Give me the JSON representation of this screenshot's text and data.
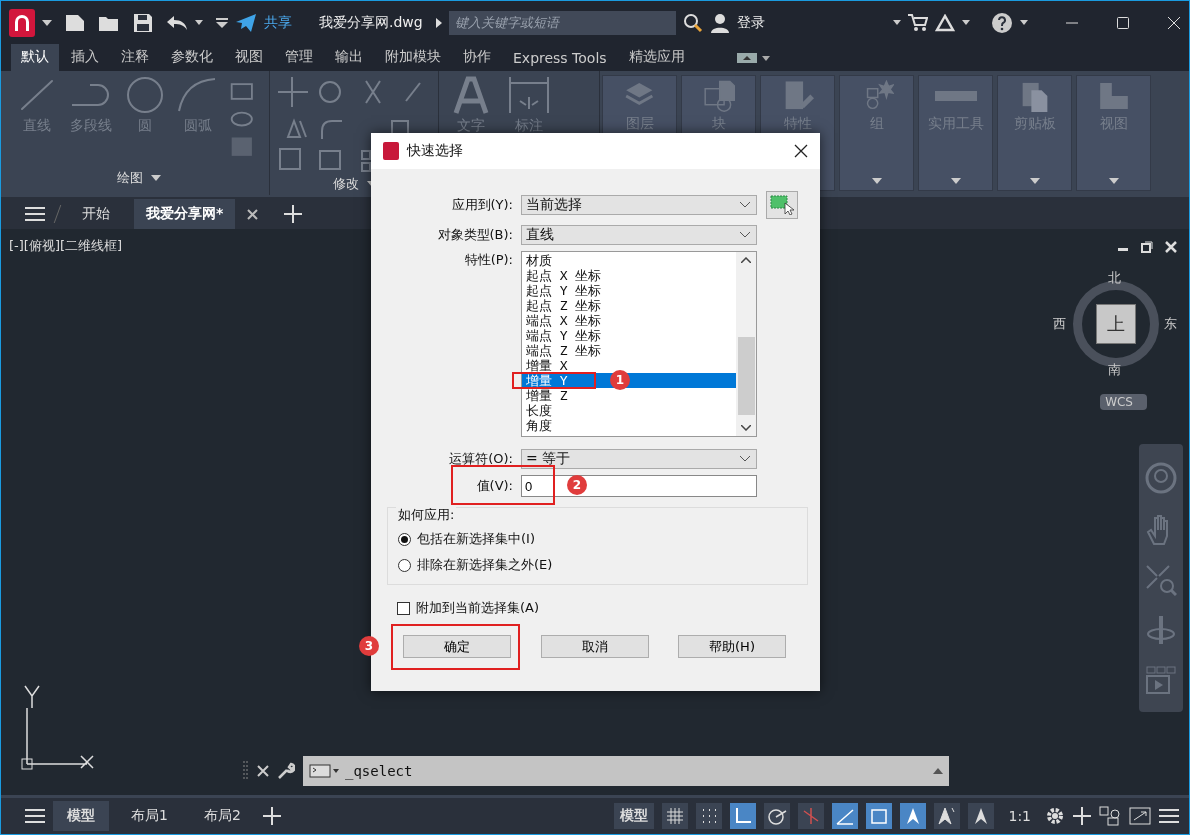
{
  "titlebar": {
    "share": "共享",
    "filename": "我爱分享网.dwg",
    "search_placeholder": "键入关键字或短语",
    "login": "登录"
  },
  "menu_tabs": [
    {
      "label": "默认",
      "selected": true
    },
    {
      "label": "插入",
      "selected": false
    },
    {
      "label": "注释",
      "selected": false
    },
    {
      "label": "参数化",
      "selected": false
    },
    {
      "label": "视图",
      "selected": false
    },
    {
      "label": "管理",
      "selected": false
    },
    {
      "label": "输出",
      "selected": false
    },
    {
      "label": "附加模块",
      "selected": false
    },
    {
      "label": "协作",
      "selected": false
    },
    {
      "label": "Express Tools",
      "selected": false
    },
    {
      "label": "精选应用",
      "selected": false
    }
  ],
  "ribbon": {
    "draw_tools": [
      "直线",
      "多段线",
      "圆",
      "圆弧"
    ],
    "draw_title": "绘图",
    "modify_title": "修改",
    "annotate_tools": [
      "文字",
      "标注"
    ],
    "big_panels": [
      {
        "kind": "layers",
        "label": "图层"
      },
      {
        "kind": "block",
        "label": "块"
      },
      {
        "kind": "properties",
        "label": "特性"
      },
      {
        "kind": "group",
        "label": "组"
      },
      {
        "kind": "utilities",
        "label": "实用工具"
      },
      {
        "kind": "clipboard",
        "label": "剪贴板"
      },
      {
        "kind": "view",
        "label": "视图"
      }
    ]
  },
  "doc_tabs": [
    {
      "label": "开始",
      "selected": false
    },
    {
      "label": "我爱分享网*",
      "selected": true
    }
  ],
  "viewport_label": "[-][俯视][二维线框]",
  "viewcube": {
    "north": "北",
    "south": "南",
    "east": "东",
    "west": "西",
    "face": "上",
    "ucs": "WCS"
  },
  "command_line": {
    "value": "_qselect"
  },
  "layout_tabs": [
    {
      "label": "模型",
      "selected": true
    },
    {
      "label": "布局1",
      "selected": false
    },
    {
      "label": "布局2",
      "selected": false
    }
  ],
  "status_bar": {
    "space": "模型",
    "scale": "1:1",
    "toggles": [
      {
        "kind": "grid",
        "on": false
      },
      {
        "kind": "snap",
        "on": false
      },
      {
        "kind": "ortho",
        "on": true
      },
      {
        "kind": "polar",
        "on": false
      },
      {
        "kind": "otrack",
        "on": false
      },
      {
        "kind": "isodraft",
        "on": true
      },
      {
        "kind": "selcycle",
        "on": true
      },
      {
        "kind": "annovis",
        "on": true
      },
      {
        "kind": "autoscale",
        "on": false
      },
      {
        "kind": "annoscale",
        "on": false
      }
    ]
  },
  "dialog": {
    "title": "快速选择",
    "apply_to_label": "应用到(Y):",
    "apply_to": "当前选择",
    "object_type_label": "对象类型(B):",
    "object_type": "直线",
    "properties_label": "特性(P):",
    "properties": [
      {
        "label": "材质",
        "selected": false
      },
      {
        "label": "起点 X 坐标",
        "selected": false
      },
      {
        "label": "起点 Y 坐标",
        "selected": false
      },
      {
        "label": "起点 Z 坐标",
        "selected": false
      },
      {
        "label": "端点 X 坐标",
        "selected": false
      },
      {
        "label": "端点 Y 坐标",
        "selected": false
      },
      {
        "label": "端点 Z 坐标",
        "selected": false
      },
      {
        "label": "增量 X",
        "selected": false
      },
      {
        "label": "增量 Y",
        "selected": true
      },
      {
        "label": "增量 Z",
        "selected": false
      },
      {
        "label": "长度",
        "selected": false
      },
      {
        "label": "角度",
        "selected": false
      }
    ],
    "operator_label": "运算符(O):",
    "operator": "= 等于",
    "value_label": "值(V):",
    "value": "0",
    "how_label": "如何应用:",
    "radios": [
      {
        "label": "包括在新选择集中(I)",
        "selected": true
      },
      {
        "label": "排除在新选择集之外(E)",
        "selected": false
      }
    ],
    "append": {
      "label": "附加到当前选择集(A)",
      "checked": false
    },
    "buttons": [
      "确定",
      "取消",
      "帮助(H)"
    ]
  },
  "annotations": [
    "1",
    "2",
    "3"
  ]
}
